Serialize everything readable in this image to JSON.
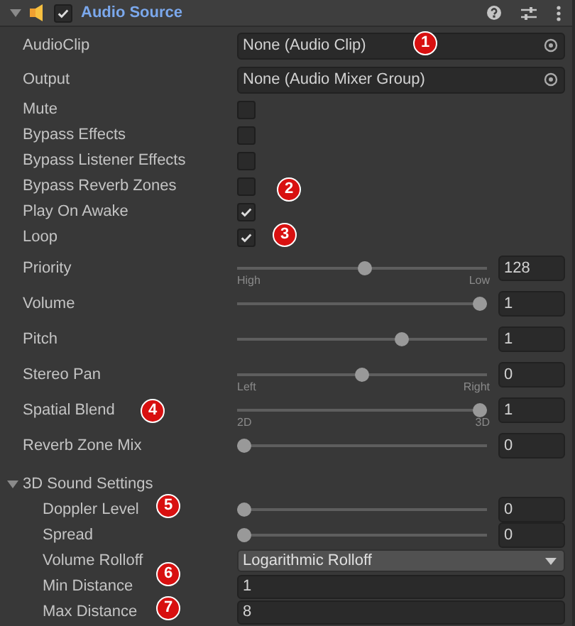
{
  "component": {
    "title": "Audio Source",
    "enabled": true,
    "expanded": true
  },
  "properties": [
    {
      "kind": "object",
      "label": "AudioClip",
      "value": "None (Audio Clip)"
    },
    {
      "kind": "object",
      "label": "Output",
      "value": "None (Audio Mixer Group)"
    },
    {
      "kind": "checkbox",
      "label": "Mute",
      "checked": false
    },
    {
      "kind": "checkbox",
      "label": "Bypass Effects",
      "checked": false
    },
    {
      "kind": "checkbox",
      "label": "Bypass Listener Effects",
      "checked": false
    },
    {
      "kind": "checkbox",
      "label": "Bypass Reverb Zones",
      "checked": false
    },
    {
      "kind": "checkbox",
      "label": "Play On Awake",
      "checked": true
    },
    {
      "kind": "checkbox",
      "label": "Loop",
      "checked": true
    },
    {
      "kind": "slider",
      "label": "Priority",
      "level": 0.51,
      "value": "128",
      "left": "High",
      "right": "Low"
    },
    {
      "kind": "slider",
      "label": "Volume",
      "level": 1,
      "value": "1"
    },
    {
      "kind": "slider",
      "label": "Pitch",
      "level": 0.67,
      "value": "1"
    },
    {
      "kind": "slider",
      "label": "Stereo Pan",
      "level": 0.5,
      "value": "0",
      "left": "Left",
      "right": "Right"
    },
    {
      "kind": "slider",
      "label": "Spatial Blend",
      "level": 1,
      "value": "1",
      "left": "2D",
      "right": "3D"
    },
    {
      "kind": "slider",
      "label": "Reverb Zone Mix",
      "level": 0,
      "value": "0"
    }
  ],
  "sound_settings": {
    "title": "3D Sound Settings",
    "expanded": true,
    "properties": [
      {
        "kind": "slider",
        "label": "Doppler Level",
        "level": 0,
        "value": "0"
      },
      {
        "kind": "slider",
        "label": "Spread",
        "level": 0,
        "value": "0"
      },
      {
        "kind": "dropdown",
        "label": "Volume Rolloff",
        "value": "Logarithmic Rolloff"
      },
      {
        "kind": "number",
        "label": "Min Distance",
        "value": "1"
      },
      {
        "kind": "number",
        "label": "Max Distance",
        "value": "8"
      }
    ]
  },
  "callouts": [
    "1",
    "2",
    "3",
    "4",
    "5",
    "6",
    "7"
  ]
}
